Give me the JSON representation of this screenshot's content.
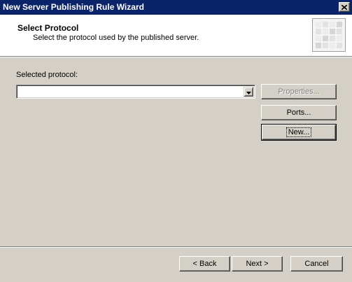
{
  "window": {
    "title": "New Server Publishing Rule Wizard"
  },
  "header": {
    "title": "Select Protocol",
    "subtitle": "Select the protocol used by the published server."
  },
  "protocol": {
    "label": "Selected protocol:",
    "value": ""
  },
  "side_buttons": {
    "properties": "Properties...",
    "ports": "Ports...",
    "new": "New..."
  },
  "footer": {
    "back": "< Back",
    "next": "Next >",
    "cancel": "Cancel"
  },
  "icons": {
    "close": "close-icon",
    "dropdown": "chevron-down-icon",
    "wizard": "wizard-header-icon"
  }
}
